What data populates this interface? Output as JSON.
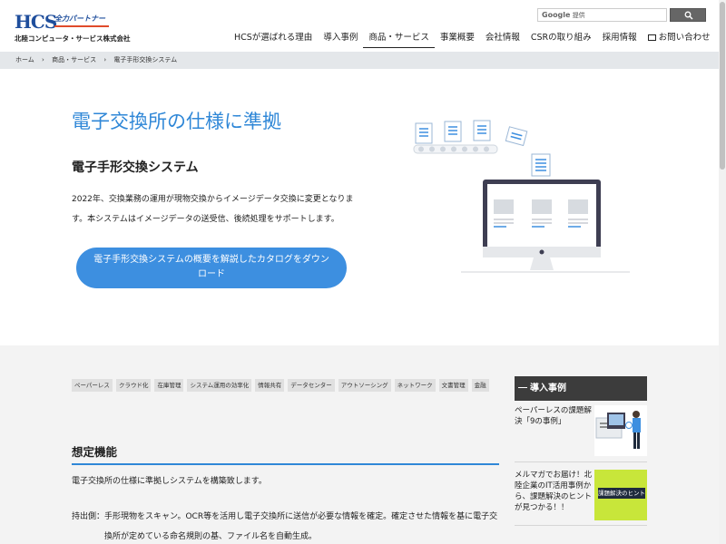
{
  "header": {
    "logo_hcs": "HCS",
    "logo_tag": "全力パートナー",
    "company": "北陸コンピュータ・サービス株式会社",
    "search_brand": "Google",
    "search_provided": "提供",
    "search_button_icon": "search-icon"
  },
  "nav": [
    {
      "label": "HCSが選ばれる理由"
    },
    {
      "label": "導入事例"
    },
    {
      "label": "商品・サービス"
    },
    {
      "label": "事業概要"
    },
    {
      "label": "会社情報"
    },
    {
      "label": "CSRの取り組み"
    },
    {
      "label": "採用情報"
    },
    {
      "label": "お問い合わせ"
    }
  ],
  "breadcrumb": [
    "ホーム",
    "商品・サービス",
    "電子手形交換システム"
  ],
  "breadcrumb_sep": "›",
  "hero": {
    "title": "電子交換所の仕様に準拠",
    "subtitle": "電子手形交換システム",
    "description": "2022年、交換業務の運用が現物交換からイメージデータ交換に変更となります。本システムはイメージデータの送受信、後続処理をサポートします。",
    "cta_label": "電子手形交換システムの概要を解説したカタログをダウンロード"
  },
  "tags": [
    "ペーパーレス",
    "クラウド化",
    "在庫管理",
    "システム運用の効率化",
    "情報共有",
    "データセンター",
    "アウトソーシング",
    "ネットワーク",
    "文書管理",
    "金融"
  ],
  "features": {
    "title": "想定機能",
    "intro": "電子交換所の仕様に準拠しシステムを構築致します。",
    "row_label": "持出側：",
    "row_text": "手形現物をスキャン。OCR等を活用し電子交換所に送信が必要な情報を確定。確定させた情報を基に電子交換所が定めている命名規則の基、ファイル名を自動生成。"
  },
  "sidebar": {
    "heading": "導入事例",
    "cards": [
      {
        "text": "ペーパーレスの課題解決「9の事例」"
      },
      {
        "text": "メルマガでお届け！北陸企業のIT活用事例から、課題解決のヒントが見つかる！！",
        "thumb_text": "課題解決のヒントを毎月"
      }
    ]
  }
}
